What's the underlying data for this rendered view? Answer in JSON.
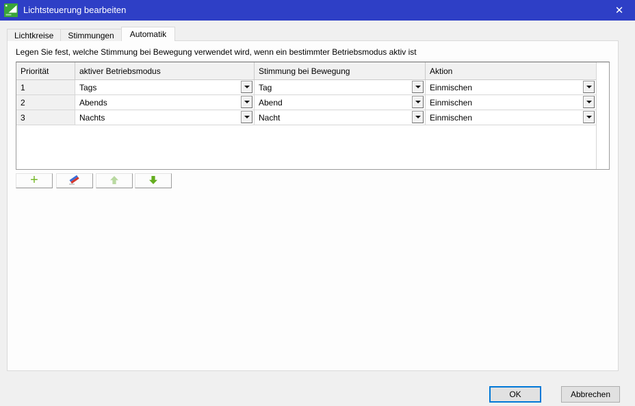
{
  "window": {
    "title": "Lichtsteuerung bearbeiten",
    "close_glyph": "✕",
    "titlebar_color": "#2e3fc6"
  },
  "tabs": [
    {
      "label": "Lichtkreise",
      "active": false
    },
    {
      "label": "Stimmungen",
      "active": false
    },
    {
      "label": "Automatik",
      "active": true
    }
  ],
  "description": "Legen Sie fest, welche Stimmung bei Bewegung verwendet wird, wenn ein bestimmter Betriebsmodus aktiv ist",
  "table": {
    "columns": [
      "Priorität",
      "aktiver Betriebsmodus",
      "Stimmung bei Bewegung",
      "Aktion"
    ],
    "rows": [
      {
        "priority": "1",
        "betriebsmodus": "Tags",
        "stimmung": "Tag",
        "aktion": "Einmischen"
      },
      {
        "priority": "2",
        "betriebsmodus": "Abends",
        "stimmung": "Abend",
        "aktion": "Einmischen"
      },
      {
        "priority": "3",
        "betriebsmodus": "Nachts",
        "stimmung": "Nacht",
        "aktion": "Einmischen"
      }
    ],
    "dropdown_glyph": "▼"
  },
  "toolbar": {
    "buttons": [
      {
        "icon": "plus-icon",
        "glyph": "+",
        "color": "#76b82a"
      },
      {
        "icon": "eraser-icon",
        "colors": [
          "#3a6fd8",
          "#d2372e"
        ]
      },
      {
        "icon": "arrow-up-icon",
        "color": "#b9d9a1",
        "disabled": true
      },
      {
        "icon": "arrow-down-icon",
        "color": "#64ad1f",
        "disabled": false
      }
    ]
  },
  "footer": {
    "ok_label": "OK",
    "cancel_label": "Abbrechen",
    "ok_border_color": "#0078d7"
  }
}
